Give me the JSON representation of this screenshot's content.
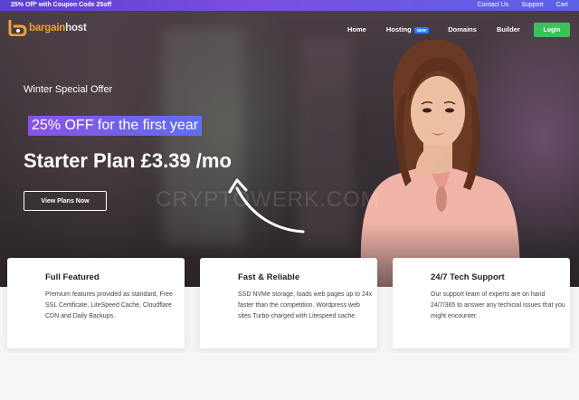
{
  "topbar": {
    "promo": "25% Off* with Coupon Code 25off",
    "links": [
      "Contact Us",
      "Support",
      "Cart"
    ]
  },
  "brand": {
    "part1": "bargain",
    "part2": "host"
  },
  "nav": {
    "items": [
      "Home",
      "Hosting",
      "Domains",
      "Builder"
    ],
    "hosting_badge": "NEW",
    "login": "Login"
  },
  "hero": {
    "eyebrow": "Winter Special Offer",
    "offer": "25% OFF for the first year",
    "plan": "Starter Plan £3.39 /mo",
    "cta": "View Plans Now",
    "watermark": "CRYPTOWERK.COM"
  },
  "features": [
    {
      "title": "Full Featured",
      "text": "Premium features provided as standard, Free SSL Certificate, LiteSpeed Cache, Cloudflare CDN and Daily Backups."
    },
    {
      "title": "Fast & Reliable",
      "text": "SSD NVMe storage, loads web pages up to 24x faster than the competition. Wordpress web sites Turbo-charged with Litespeed cache."
    },
    {
      "title": "24/7 Tech Support",
      "text": "Our support team of experts are on hand 24/7/365 to answer any techicial issues that you might encounter."
    }
  ],
  "colors": {
    "accent_green": "#3cc15a",
    "brand_orange": "#f0a030",
    "offer_gradient_start": "#8a52e8",
    "offer_gradient_end": "#5f6ff0"
  }
}
